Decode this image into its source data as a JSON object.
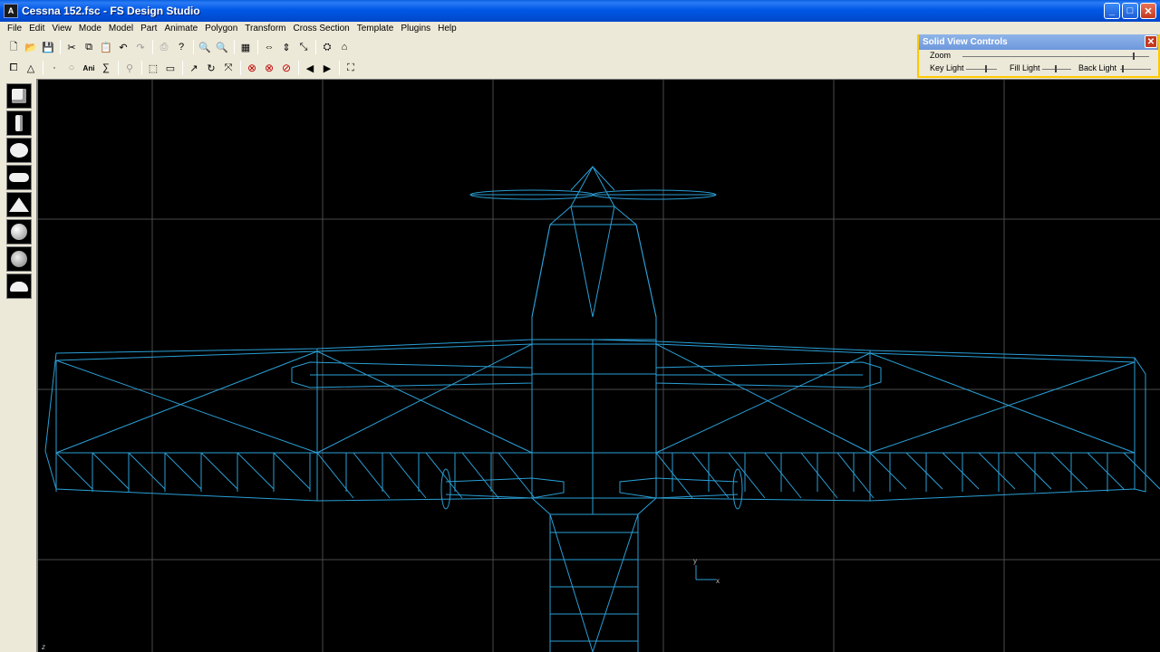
{
  "window": {
    "title": "Cessna 152.fsc - FS Design Studio",
    "app_icon": "fsds-logo",
    "buttons": {
      "minimize": "_",
      "maximize": "□",
      "close": "✕"
    }
  },
  "menu": [
    "File",
    "Edit",
    "View",
    "Mode",
    "Model",
    "Part",
    "Animate",
    "Polygon",
    "Transform",
    "Cross Section",
    "Template",
    "Plugins",
    "Help"
  ],
  "toolbar1": [
    {
      "icon": "new-file-icon",
      "glyph": "🗋"
    },
    {
      "icon": "open-folder-icon",
      "glyph": "📂"
    },
    {
      "icon": "save-icon",
      "glyph": "💾"
    },
    {
      "sep": true
    },
    {
      "icon": "cut-icon",
      "glyph": "✂"
    },
    {
      "icon": "copy-icon",
      "glyph": "⧉"
    },
    {
      "icon": "paste-icon",
      "glyph": "📋",
      "disabled": true
    },
    {
      "icon": "undo-icon",
      "glyph": "↶"
    },
    {
      "icon": "redo-icon",
      "glyph": "↷",
      "disabled": true
    },
    {
      "sep": true
    },
    {
      "icon": "print-icon",
      "glyph": "⎙",
      "disabled": true
    },
    {
      "icon": "help-icon",
      "glyph": "?"
    },
    {
      "sep": true
    },
    {
      "icon": "zoom-in-icon",
      "glyph": "🔍"
    },
    {
      "icon": "zoom-out-icon",
      "glyph": "🔍"
    },
    {
      "sep": true
    },
    {
      "icon": "grid-icon",
      "glyph": "▦"
    },
    {
      "sep": true
    },
    {
      "icon": "scale-x-icon",
      "glyph": "⇔"
    },
    {
      "icon": "scale-y-icon",
      "glyph": "⇕"
    },
    {
      "icon": "scale-z-icon",
      "glyph": "⤡"
    },
    {
      "sep": true
    },
    {
      "icon": "view-3d-icon",
      "glyph": "⛭"
    },
    {
      "icon": "home-view-icon",
      "glyph": "⌂"
    }
  ],
  "toolbar2": [
    {
      "icon": "select-part-icon",
      "glyph": "⧠"
    },
    {
      "icon": "select-triangle-icon",
      "glyph": "△"
    },
    {
      "sep": true
    },
    {
      "icon": "vertex-icon",
      "glyph": "·"
    },
    {
      "icon": "circle-select-icon",
      "glyph": "○",
      "disabled": true
    },
    {
      "icon": "animation-icon",
      "glyph": "Ani"
    },
    {
      "icon": "sum-icon",
      "glyph": "∑"
    },
    {
      "sep": true
    },
    {
      "icon": "lasso-icon",
      "glyph": "⚲",
      "disabled": true
    },
    {
      "sep": true
    },
    {
      "icon": "rect-select-icon",
      "glyph": "⬚"
    },
    {
      "icon": "measure-icon",
      "glyph": "▭"
    },
    {
      "sep": true
    },
    {
      "icon": "move-icon",
      "glyph": "↗"
    },
    {
      "icon": "rotate-icon",
      "glyph": "↻"
    },
    {
      "icon": "scale-icon",
      "glyph": "⤧"
    },
    {
      "sep": true
    },
    {
      "icon": "stop-x-icon",
      "glyph": "⊗",
      "red": true
    },
    {
      "icon": "stop-y-icon",
      "glyph": "⊗",
      "red": true
    },
    {
      "icon": "stop-z-icon",
      "glyph": "⊘",
      "red": true
    },
    {
      "sep": true
    },
    {
      "icon": "prev-icon",
      "glyph": "◀"
    },
    {
      "icon": "next-icon",
      "glyph": "▶"
    },
    {
      "sep": true
    },
    {
      "icon": "binoculars-icon",
      "glyph": "⛶"
    }
  ],
  "solid_view": {
    "title": "Solid View Controls",
    "zoom_label": "Zoom",
    "zoom": 0.92,
    "key_light_label": "Key Light",
    "key_light": 0.65,
    "fill_light_label": "Fill Light",
    "fill_light": 0.45,
    "back_light_label": "Back Light",
    "back_light": 0.05
  },
  "palette": [
    "cube-tool-icon",
    "cylinder-tool-icon",
    "sphere-tool-icon",
    "capsule-tool-icon",
    "cone-tool-icon",
    "geosphere-tool-icon",
    "faceted-sphere-tool-icon",
    "dome-tool-icon"
  ],
  "viewport": {
    "background": "#000000",
    "grid_color": "#4a4a4a",
    "wire_color": "#2a9fd6",
    "axis_labels": {
      "y": "y",
      "x": "x"
    },
    "corner_label": "z"
  }
}
